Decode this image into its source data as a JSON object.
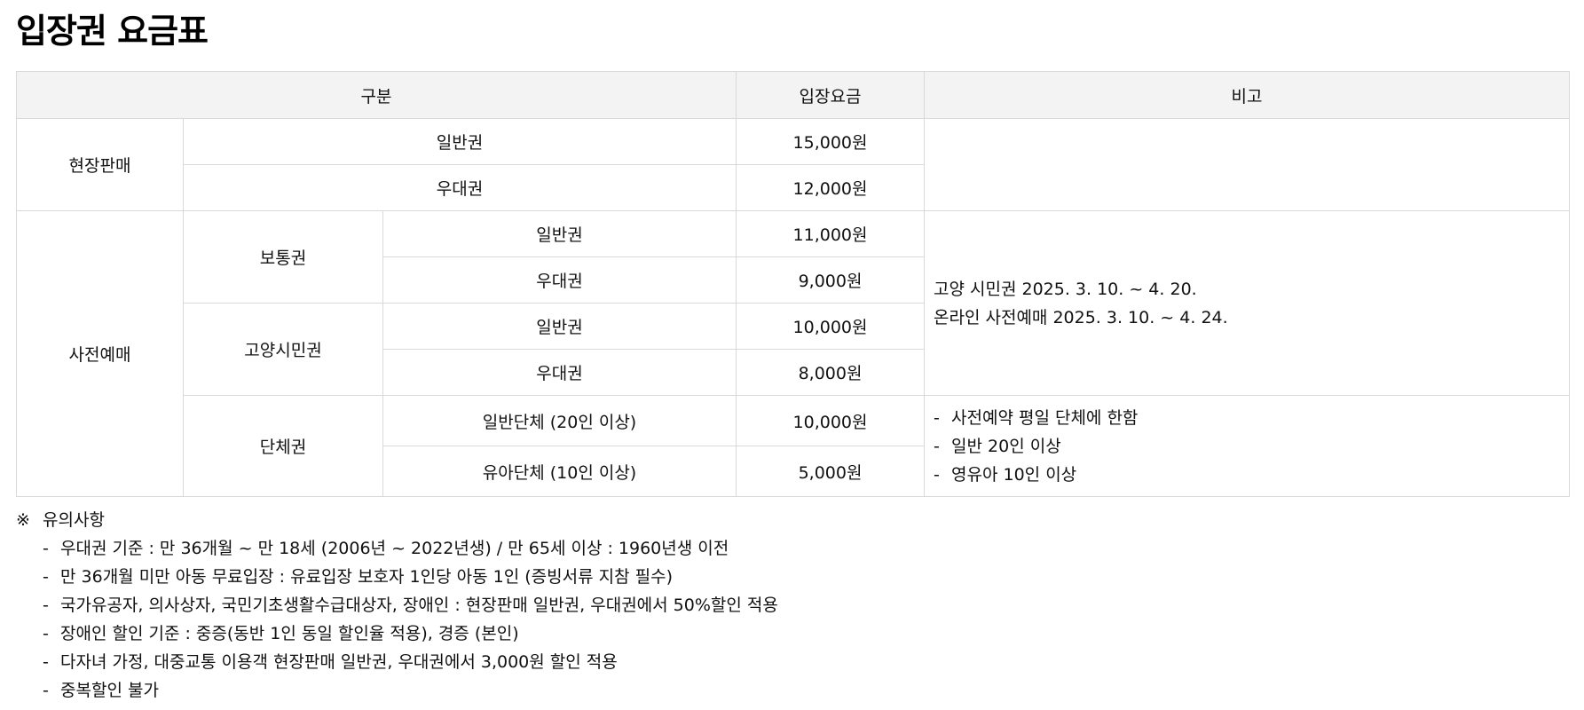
{
  "page_title": "입장권 요금표",
  "table": {
    "headers": {
      "category": "구분",
      "price": "입장요금",
      "remarks": "비고"
    },
    "onsite": {
      "label": "현장판매",
      "general": {
        "label": "일반권",
        "price": "15,000원"
      },
      "discount": {
        "label": "우대권",
        "price": "12,000원"
      }
    },
    "advance": {
      "label": "사전예매",
      "regular": {
        "label": "보통권",
        "general": {
          "label": "일반권",
          "price": "11,000원"
        },
        "discount": {
          "label": "우대권",
          "price": "9,000원"
        }
      },
      "citizen": {
        "label": "고양시민권",
        "general": {
          "label": "일반권",
          "price": "10,000원"
        },
        "discount": {
          "label": "우대권",
          "price": "8,000원"
        }
      },
      "group": {
        "label": "단체권",
        "general": {
          "label": "일반단체 (20인 이상)",
          "price": "10,000원"
        },
        "child": {
          "label": "유아단체 (10인 이상)",
          "price": "5,000원"
        }
      },
      "remarks_advance": [
        "고양 시민권 2025. 3. 10. ~ 4. 20.",
        "온라인 사전예매 2025. 3. 10. ~ 4. 24."
      ],
      "remarks_group": [
        "사전예약 평일 단체에 한함",
        "일반 20인 이상",
        "영유아 10인 이상"
      ]
    }
  },
  "notice": {
    "mark": "※",
    "title": "유의사항",
    "items": [
      "우대권 기준 : 만 36개월 ~ 만 18세 (2006년 ~ 2022년생) / 만 65세 이상 : 1960년생 이전",
      "만 36개월 미만 아동 무료입장 : 유료입장 보호자 1인당 아동 1인 (증빙서류 지참 필수)",
      "국가유공자, 의사상자, 국민기초생활수급대상자, 장애인 : 현장판매 일반권, 우대권에서 50%할인 적용",
      "장애인 할인 기준 : 중증(동반 1인 동일 할인율 적용), 경증 (본인)",
      "다자녀 가정, 대중교통 이용객 현장판매 일반권, 우대권에서 3,000원 할인 적용",
      "중복할인 불가"
    ]
  }
}
